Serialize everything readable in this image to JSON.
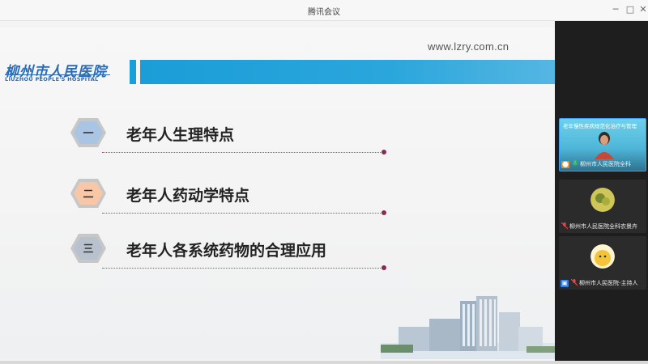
{
  "window": {
    "title": "腾讯会议",
    "min_glyph": "─",
    "max_glyph": "□",
    "close_glyph": "✕"
  },
  "slide": {
    "logo_cn": "柳州市人民医院",
    "logo_en": "LIUZHOU PEOPLE'S HOSPITAL",
    "url": "www.lzry.com.cn",
    "accent_color": "#1aa0d8",
    "items": [
      {
        "num": "一",
        "text": "老年人生理特点",
        "hex_color": "#aac4e4"
      },
      {
        "num": "二",
        "text": "老年人药动学特点",
        "hex_color": "#f7c7a8"
      },
      {
        "num": "三",
        "text": "老年人各系统药物的合理应用",
        "hex_color": "#b8c2cf"
      }
    ]
  },
  "participants": [
    {
      "caption": "老年慢性疾病规范化治疗与管理",
      "name": "柳州市人民医院全科",
      "badge": "host"
    },
    {
      "caption": "",
      "name": "柳州市人民医院全科农景卉",
      "badge": ""
    },
    {
      "caption": "",
      "name": "柳州市人民医院-主持人",
      "badge": "screen"
    }
  ]
}
